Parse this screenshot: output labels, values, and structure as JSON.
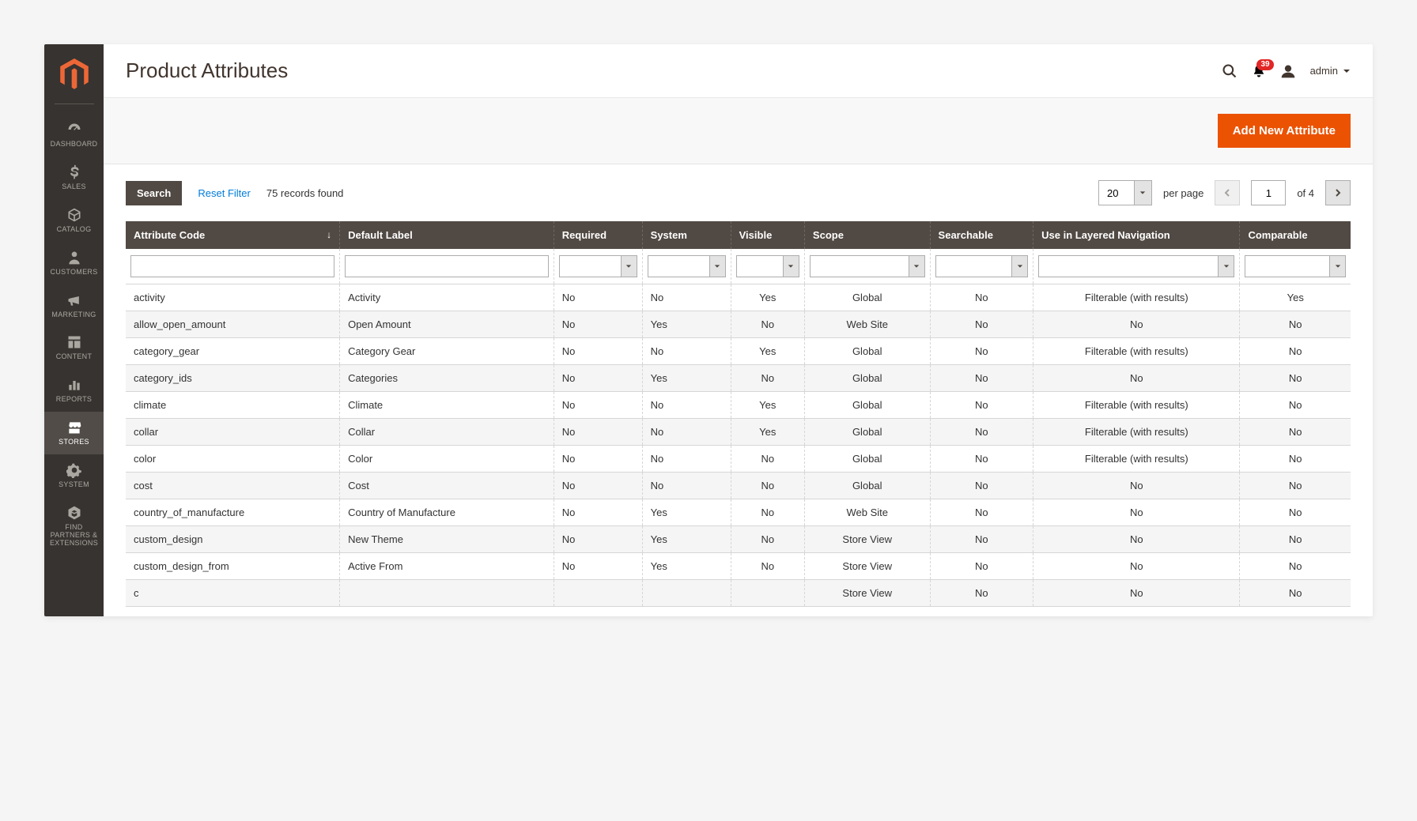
{
  "header": {
    "title": "Product Attributes",
    "notif_count": "39",
    "username": "admin"
  },
  "sidebar": {
    "items": [
      {
        "label": "DASHBOARD",
        "icon": "dashboard-icon"
      },
      {
        "label": "SALES",
        "icon": "dollar-icon"
      },
      {
        "label": "CATALOG",
        "icon": "cube-icon"
      },
      {
        "label": "CUSTOMERS",
        "icon": "person-icon"
      },
      {
        "label": "MARKETING",
        "icon": "megaphone-icon"
      },
      {
        "label": "CONTENT",
        "icon": "layout-icon"
      },
      {
        "label": "REPORTS",
        "icon": "bars-icon"
      },
      {
        "label": "STORES",
        "icon": "store-icon"
      },
      {
        "label": "SYSTEM",
        "icon": "gear-icon"
      },
      {
        "label": "FIND PARTNERS & EXTENSIONS",
        "icon": "partners-icon"
      }
    ]
  },
  "actions": {
    "add_label": "Add New Attribute"
  },
  "controls": {
    "search_label": "Search",
    "reset_label": "Reset Filter",
    "records_found": "75 records found",
    "per_page_value": "20",
    "per_page_label": "per page",
    "page_current": "1",
    "of_pages": "of 4"
  },
  "table": {
    "columns": [
      {
        "label": "Attribute Code",
        "filter": "text",
        "align": "left",
        "sorted": "asc"
      },
      {
        "label": "Default Label",
        "filter": "text",
        "align": "left"
      },
      {
        "label": "Required",
        "filter": "select",
        "align": "left"
      },
      {
        "label": "System",
        "filter": "select",
        "align": "left"
      },
      {
        "label": "Visible",
        "filter": "select",
        "align": "center"
      },
      {
        "label": "Scope",
        "filter": "select",
        "align": "center"
      },
      {
        "label": "Searchable",
        "filter": "select",
        "align": "center"
      },
      {
        "label": "Use in Layered Navigation",
        "filter": "select",
        "align": "center"
      },
      {
        "label": "Comparable",
        "filter": "select",
        "align": "center"
      }
    ],
    "rows": [
      [
        "activity",
        "Activity",
        "No",
        "No",
        "Yes",
        "Global",
        "No",
        "Filterable (with results)",
        "Yes"
      ],
      [
        "allow_open_amount",
        "Open Amount",
        "No",
        "Yes",
        "No",
        "Web Site",
        "No",
        "No",
        "No"
      ],
      [
        "category_gear",
        "Category Gear",
        "No",
        "No",
        "Yes",
        "Global",
        "No",
        "Filterable (with results)",
        "No"
      ],
      [
        "category_ids",
        "Categories",
        "No",
        "Yes",
        "No",
        "Global",
        "No",
        "No",
        "No"
      ],
      [
        "climate",
        "Climate",
        "No",
        "No",
        "Yes",
        "Global",
        "No",
        "Filterable (with results)",
        "No"
      ],
      [
        "collar",
        "Collar",
        "No",
        "No",
        "Yes",
        "Global",
        "No",
        "Filterable (with results)",
        "No"
      ],
      [
        "color",
        "Color",
        "No",
        "No",
        "No",
        "Global",
        "No",
        "Filterable (with results)",
        "No"
      ],
      [
        "cost",
        "Cost",
        "No",
        "No",
        "No",
        "Global",
        "No",
        "No",
        "No"
      ],
      [
        "country_of_manufacture",
        "Country of Manufacture",
        "No",
        "Yes",
        "No",
        "Web Site",
        "No",
        "No",
        "No"
      ],
      [
        "custom_design",
        "New Theme",
        "No",
        "Yes",
        "No",
        "Store View",
        "No",
        "No",
        "No"
      ],
      [
        "custom_design_from",
        "Active From",
        "No",
        "Yes",
        "No",
        "Store View",
        "No",
        "No",
        "No"
      ],
      [
        "c",
        "",
        "",
        "",
        "",
        "Store View",
        "No",
        "No",
        "No"
      ]
    ]
  }
}
